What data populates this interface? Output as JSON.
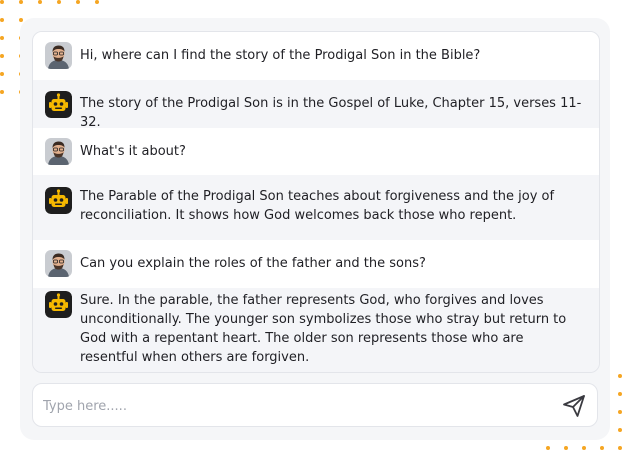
{
  "colors": {
    "dot_color": "#f5a623",
    "bot_avatar_bg": "#1e1e1e",
    "bot_avatar_face": "#f5b800"
  },
  "messages": [
    {
      "role": "user",
      "avatar": "user-avatar",
      "text": "Hi, where can I find the story of the Prodigal Son in the Bible?"
    },
    {
      "role": "bot",
      "avatar": "robot-icon",
      "text": "The story of the Prodigal Son is in the Gospel of Luke, Chapter 15, verses 11-32."
    },
    {
      "role": "user",
      "avatar": "user-avatar",
      "text": "What's it about?"
    },
    {
      "role": "bot",
      "avatar": "robot-icon",
      "text": "The Parable of the Prodigal Son teaches about forgiveness and the joy of reconciliation. It shows how God welcomes back those who repent."
    },
    {
      "role": "user",
      "avatar": "user-avatar",
      "text": "Can you explain the roles of the father and the sons?"
    },
    {
      "role": "bot",
      "avatar": "robot-icon",
      "text": "Sure. In the parable, the father represents God, who forgives and loves unconditionally. The younger son symbolizes those who stray but return to God with a repentant heart. The older son represents those who are resentful when others are forgiven."
    }
  ],
  "composer": {
    "placeholder": "Type here.....",
    "value": "",
    "send_icon": "send-icon"
  }
}
